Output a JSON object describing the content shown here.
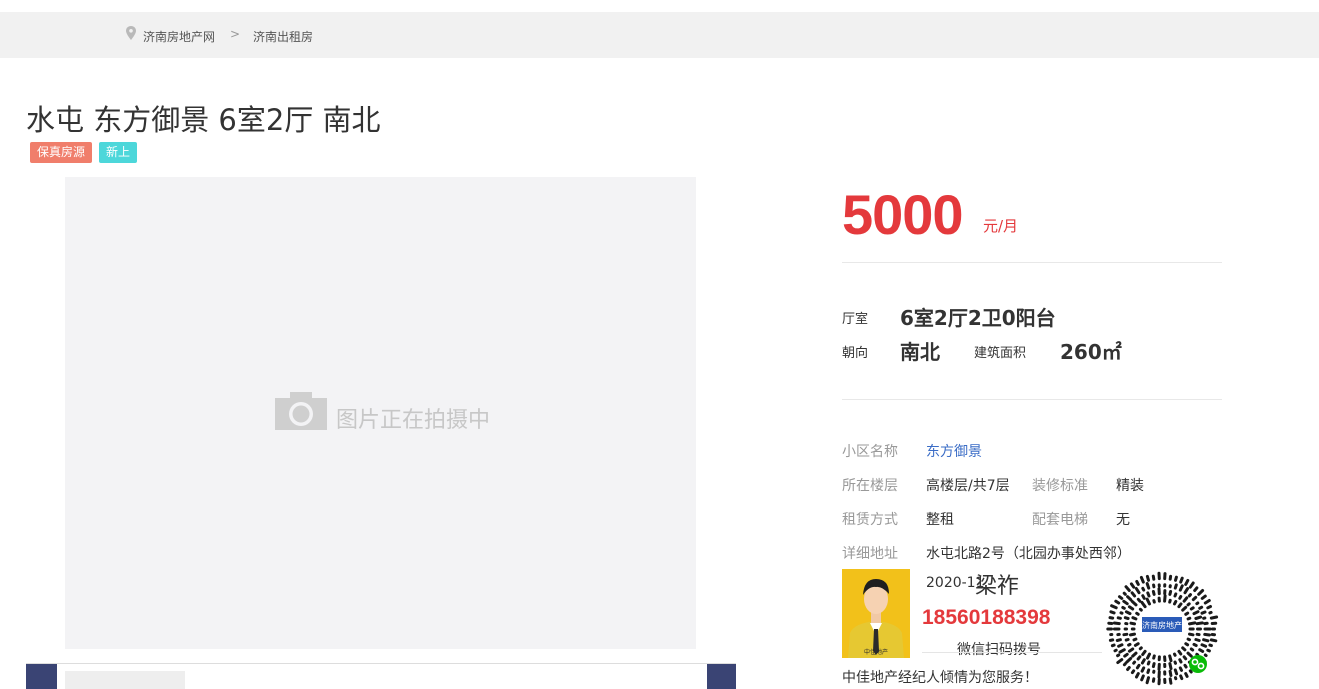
{
  "breadcrumb": {
    "items": [
      "济南房地产网",
      "济南出租房"
    ],
    "separator": ">"
  },
  "listing": {
    "title": "水屯 东方御景 6室2厅 南北",
    "tags": [
      "保真房源",
      "新上"
    ],
    "photo_placeholder": "图片正在拍摄中"
  },
  "price": {
    "amount": "5000",
    "unit": "元/月"
  },
  "summary": {
    "layout_label": "厅室",
    "layout_value": "6室2厅2卫0阳台",
    "orientation_label": "朝向",
    "orientation_value": "南北",
    "area_label": "建筑面积",
    "area_value": "260㎡"
  },
  "details": {
    "community_label": "小区名称",
    "community_value": "东方御景",
    "floor_label": "所在楼层",
    "floor_value": "高楼层/共7层",
    "decoration_label": "装修标准",
    "decoration_value": "精装",
    "rent_label": "租赁方式",
    "rent_value": "整租",
    "elevator_label": "配套电梯",
    "elevator_value": "无",
    "address_label": "详细地址",
    "address_value": "水屯北路2号（北园办事处西邻）"
  },
  "agent": {
    "name": "梁祚",
    "date": "2020-11",
    "phone": "18560188398",
    "wechat_hint": "微信扫码拨号",
    "service_text": "中佳地产经纪人倾情为您服务！",
    "badge_text": "中佳地产"
  },
  "qr": {
    "brand": "济南房地产"
  },
  "colors": {
    "price_red": "#e4393c",
    "tag_verified": "#f07e6b",
    "tag_new": "#4dd7da",
    "link_blue": "#3a6cc6",
    "thumb_nav": "#3a4474"
  }
}
